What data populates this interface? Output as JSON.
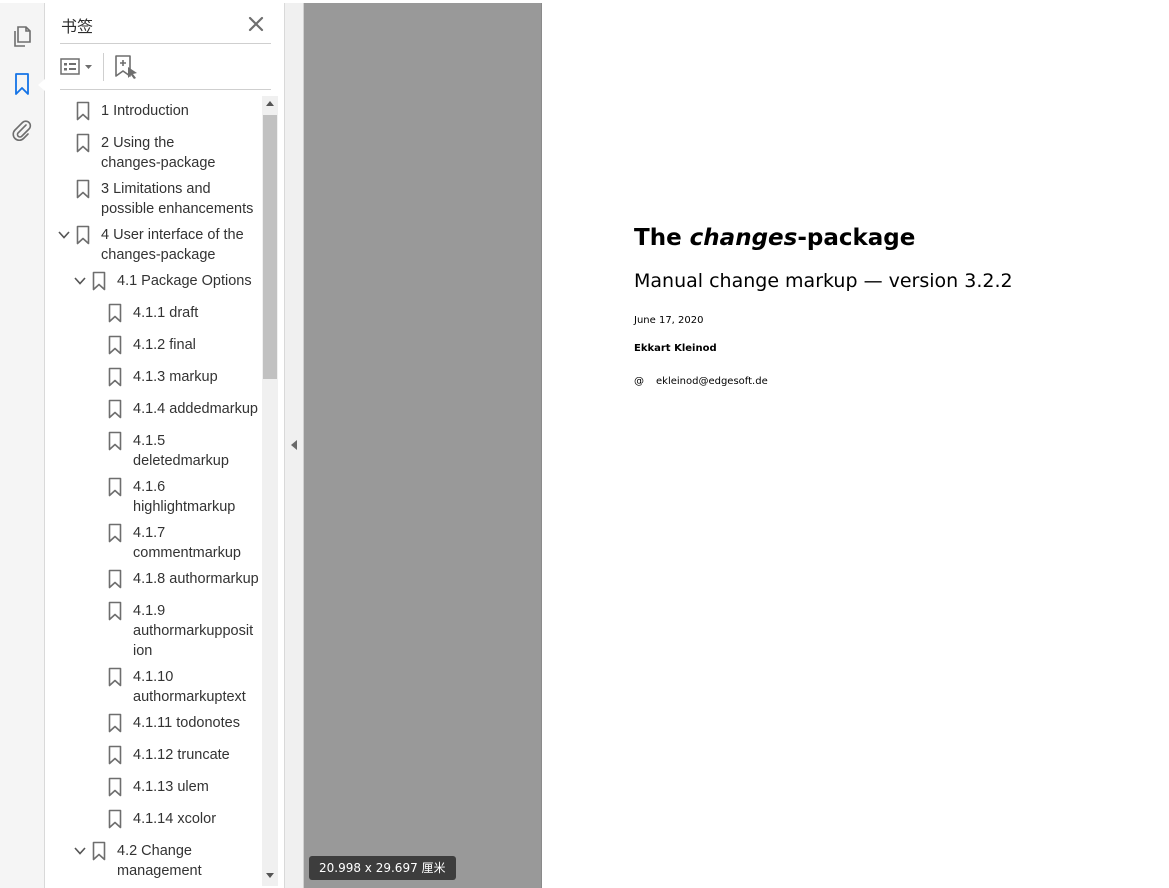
{
  "colors": {
    "accent": "#1473e6",
    "icon_gray": "#6e6e6e",
    "doc_background": "#999999"
  },
  "icons": {
    "rail": [
      "copy-pages-icon",
      "bookmark-icon",
      "paperclip-icon"
    ],
    "panel": [
      "close-icon",
      "options-list-icon",
      "chevron-down-icon",
      "new-bookmark-icon"
    ]
  },
  "panel": {
    "title": "书签",
    "bookmarks": [
      {
        "id": "b1",
        "label": "1 Introduction",
        "level": 0,
        "expanded": null
      },
      {
        "id": "b2",
        "label": "2 Using the\nchanges-package",
        "level": 0,
        "expanded": null
      },
      {
        "id": "b3",
        "label": "3 Limitations and\npossible enhancements",
        "level": 0,
        "expanded": null
      },
      {
        "id": "b4",
        "label": "4 User interface of the\nchanges-package",
        "level": 0,
        "expanded": true
      },
      {
        "id": "b41",
        "label": "4.1 Package Options",
        "level": 1,
        "expanded": true
      },
      {
        "id": "b411",
        "label": "4.1.1 draft",
        "level": 2,
        "expanded": null
      },
      {
        "id": "b412",
        "label": "4.1.2 final",
        "level": 2,
        "expanded": null
      },
      {
        "id": "b413",
        "label": "4.1.3 markup",
        "level": 2,
        "expanded": null
      },
      {
        "id": "b414",
        "label": "4.1.4 addedmarkup",
        "level": 2,
        "expanded": null
      },
      {
        "id": "b415",
        "label": "4.1.5\ndeletedmarkup",
        "level": 2,
        "expanded": null
      },
      {
        "id": "b416",
        "label": "4.1.6\nhighlightmarkup",
        "level": 2,
        "expanded": null
      },
      {
        "id": "b417",
        "label": "4.1.7\ncommentmarkup",
        "level": 2,
        "expanded": null
      },
      {
        "id": "b418",
        "label": "4.1.8 authormarkup",
        "level": 2,
        "expanded": null
      },
      {
        "id": "b419",
        "label": "4.1.9\nauthormarkupposit\nion",
        "level": 2,
        "expanded": null
      },
      {
        "id": "b4110",
        "label": "4.1.10\nauthormarkuptext",
        "level": 2,
        "expanded": null
      },
      {
        "id": "b4111",
        "label": "4.1.11 todonotes",
        "level": 2,
        "expanded": null
      },
      {
        "id": "b4112",
        "label": "4.1.12 truncate",
        "level": 2,
        "expanded": null
      },
      {
        "id": "b4113",
        "label": "4.1.13 ulem",
        "level": 2,
        "expanded": null
      },
      {
        "id": "b4114",
        "label": "4.1.14 xcolor",
        "level": 2,
        "expanded": null
      },
      {
        "id": "b42",
        "label": "4.2 Change\nmanagement",
        "level": 1,
        "expanded": true
      }
    ]
  },
  "document": {
    "title_prefix": "The ",
    "title_emph": "changes",
    "title_suffix": "-package",
    "subtitle": "Manual change markup — version 3.2.2",
    "date": "June 17, 2020",
    "author": "Ekkart Kleinod",
    "email_symbol": "@",
    "email": "ekleinod@edgesoft.de"
  },
  "status": {
    "page_size": "20.998 x 29.697 厘米"
  }
}
